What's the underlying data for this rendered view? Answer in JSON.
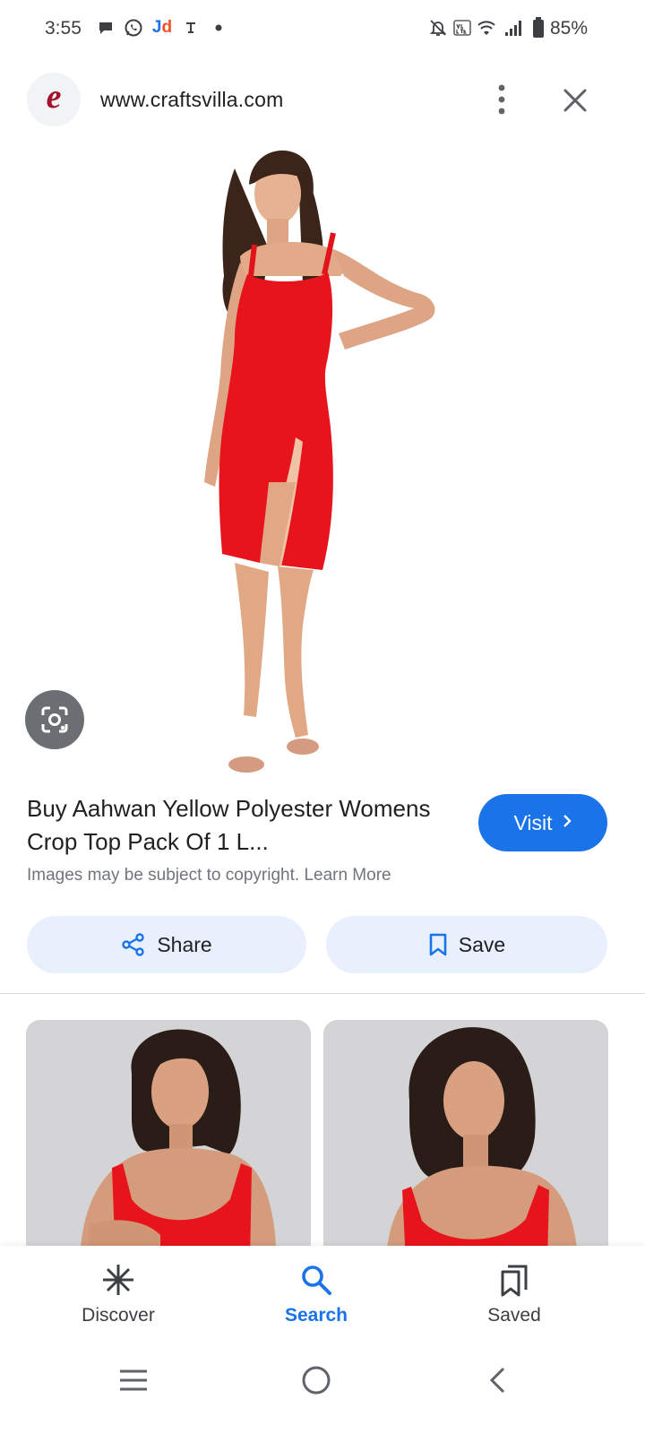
{
  "status_bar": {
    "time": "3:55",
    "jd_label_j": "J",
    "jd_label_d": "d",
    "battery": "85%",
    "icons": [
      "chat-bubble-icon",
      "whatsapp-icon",
      "jd-app-icon",
      "download-notification-icon",
      "dot-icon",
      "mute-icon",
      "volte-icon",
      "wifi-icon",
      "signal-icon",
      "battery-icon"
    ]
  },
  "header": {
    "logo_letter": "e",
    "url": "www.craftsvilla.com",
    "more_icon": "more-vert-icon",
    "close_icon": "close-icon"
  },
  "result": {
    "title": "Buy Aahwan Yellow Polyester Womens Crop Top Pack Of 1 L...",
    "visit_label": "Visit",
    "copyright_text": "Images may be subject to copyright.",
    "learn_more": "Learn More",
    "share_label": "Share",
    "save_label": "Save"
  },
  "bottom_nav": {
    "items": [
      {
        "label": "Discover",
        "icon": "asterisk-icon",
        "active": false
      },
      {
        "label": "Search",
        "icon": "search-icon",
        "active": true
      },
      {
        "label": "Saved",
        "icon": "saved-collection-icon",
        "active": false
      }
    ]
  },
  "colors": {
    "accent": "#1a73e8",
    "button_bg": "#e8f0fe",
    "dress_red": "#e8141b",
    "logo_red": "#a3112e"
  }
}
